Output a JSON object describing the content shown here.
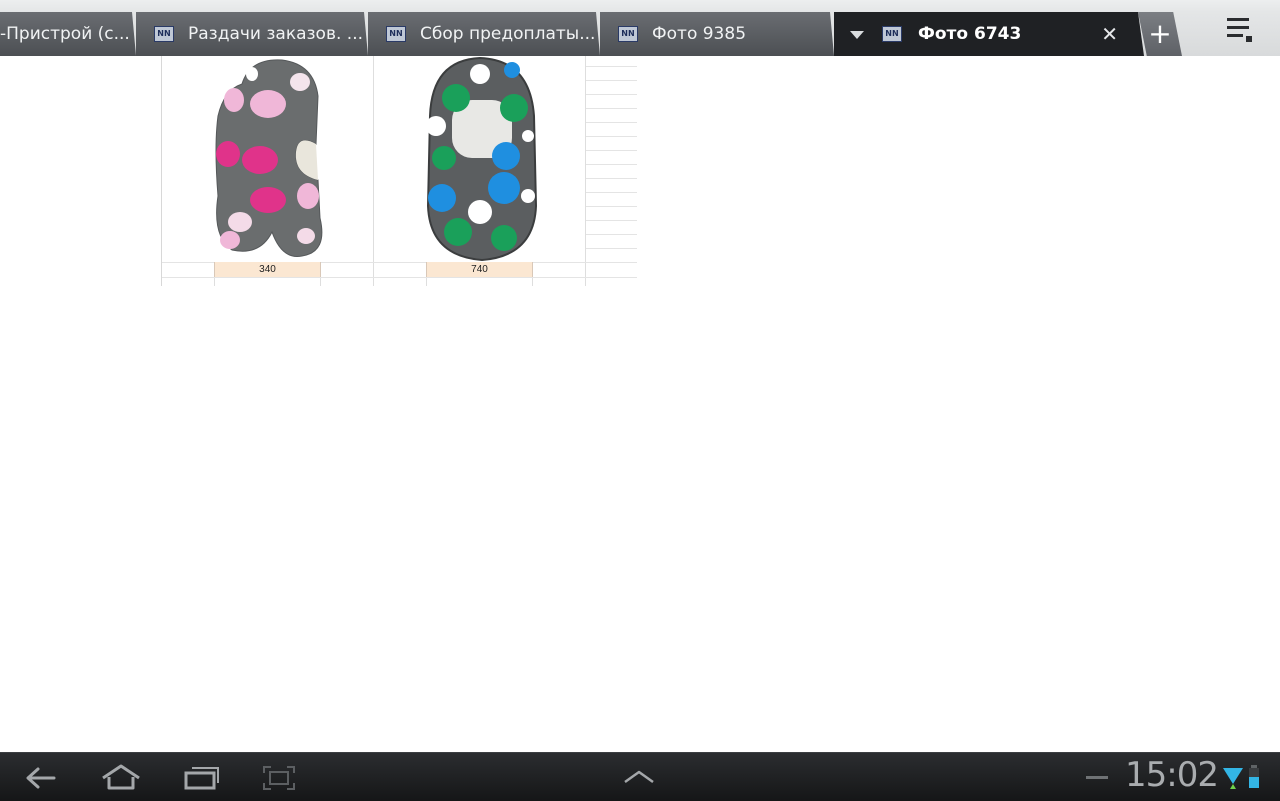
{
  "tabs": [
    {
      "label": "-Пристрой (с...",
      "icon": "nn-icon",
      "active": false
    },
    {
      "label": "Раздачи заказов. ...",
      "icon": "nn-icon",
      "active": false
    },
    {
      "label": "Сбор предоплаты...",
      "icon": "nn-icon",
      "active": false
    },
    {
      "label": "Фото 9385",
      "icon": "nn-icon",
      "active": false
    },
    {
      "label": "Фото 6743",
      "icon": "nn-icon",
      "active": true
    }
  ],
  "tab_icon_text": "NN",
  "new_tab_label": "+",
  "close_label": "✕",
  "products": [
    {
      "price": "340",
      "pattern_colors": [
        "#f0b7d8",
        "#e0338a",
        "#ffffff"
      ],
      "base_color": "#6a6d6e"
    },
    {
      "price": "740",
      "pattern_colors": [
        "#1f8fe0",
        "#1aa05a",
        "#ffffff"
      ],
      "base_color": "#5b5e60"
    }
  ],
  "status": {
    "time": "15:02",
    "wifi_color": "#33b5e5",
    "battery_color": "#33b5e5"
  },
  "nav": {
    "back": "back-icon",
    "home": "home-icon",
    "recent": "recent-apps-icon",
    "screenshot": "screenshot-icon",
    "up": "chevron-up-icon"
  }
}
